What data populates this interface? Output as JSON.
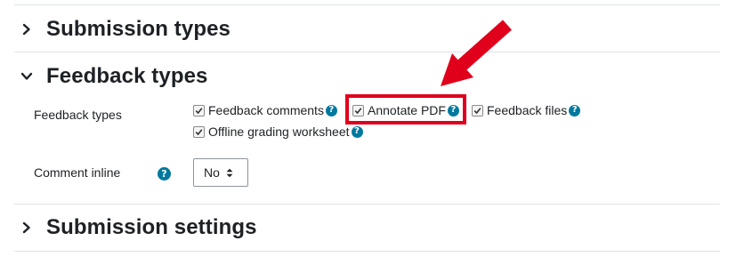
{
  "sections": [
    {
      "title": "Submission types",
      "expanded": false
    },
    {
      "title": "Feedback types",
      "expanded": true
    },
    {
      "title": "Submission settings",
      "expanded": false
    }
  ],
  "feedback": {
    "field_label": "Feedback types",
    "options": [
      {
        "label": "Feedback comments",
        "checked": true
      },
      {
        "label": "Annotate PDF",
        "checked": true
      },
      {
        "label": "Feedback files",
        "checked": true
      },
      {
        "label": "Offline grading worksheet",
        "checked": true
      }
    ]
  },
  "comment_inline": {
    "label": "Comment inline",
    "value": "No"
  },
  "help_glyph": "?",
  "colors": {
    "help_icon": "#00799e",
    "highlight": "#e0001b",
    "arrow": "#e0001b"
  }
}
